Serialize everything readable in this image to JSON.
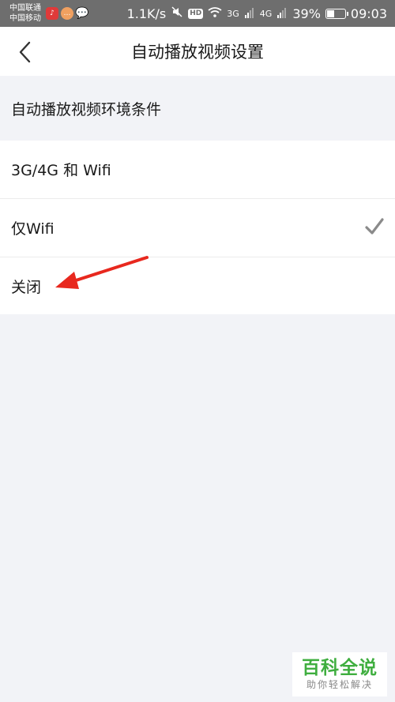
{
  "status_bar": {
    "carrier1": "中国联通",
    "carrier2": "中国移动",
    "net_speed": "1.1K/s",
    "hd": "HD",
    "net1": "3G",
    "net2": "4G",
    "battery_percent": "39%",
    "battery_level": 0.39,
    "time": "09:03"
  },
  "header": {
    "title": "自动播放视频设置"
  },
  "section": {
    "label": "自动播放视频环境条件"
  },
  "options": [
    {
      "label": "3G/4G 和 Wifi",
      "selected": false
    },
    {
      "label": "仅Wifi",
      "selected": true
    },
    {
      "label": "关闭",
      "selected": false
    }
  ],
  "watermark": {
    "main": "百科全说",
    "sub": "助你轻松解决"
  },
  "colors": {
    "background": "#f2f3f7",
    "status_bar": "#6e6e6e",
    "arrow": "#e8281e",
    "check": "#8a8a8a",
    "watermark_green": "#3fae3f"
  },
  "icons": {
    "back": "chevron-left-icon",
    "check": "check-icon"
  }
}
